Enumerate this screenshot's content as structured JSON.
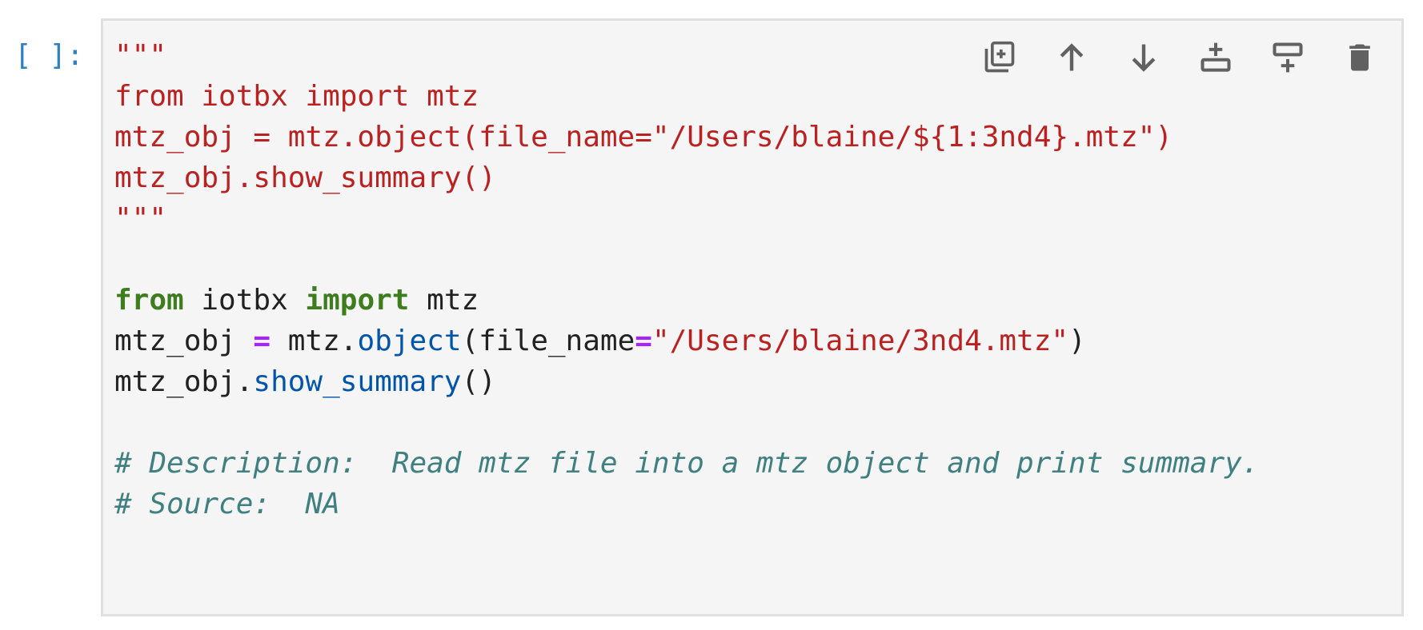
{
  "cell": {
    "prompt": "[ ]:",
    "toolbar": {
      "icons": [
        "duplicate-cell-icon",
        "move-up-icon",
        "move-down-icon",
        "insert-below-icon",
        "insert-above-icon",
        "delete-icon"
      ],
      "icon_color": "#616161"
    },
    "code": {
      "l1": "\"\"\"",
      "l2": "from iotbx import mtz",
      "l3": "mtz_obj = mtz.object(file_name=\"/Users/blaine/${1:3nd4}.mtz\")",
      "l4": "mtz_obj.show_summary()",
      "l5": "\"\"\"",
      "l7_kw1": "from",
      "l7_mid": " iotbx ",
      "l7_kw2": "import",
      "l7_end": " mtz",
      "l8_a": "mtz_obj ",
      "l8_op": "=",
      "l8_b": " mtz.",
      "l8_fn": "object",
      "l8_c": "(file_name",
      "l8_eq": "=",
      "l8_str": "\"/Users/blaine/3nd4.mtz\"",
      "l8_d": ")",
      "l9_a": "mtz_obj.",
      "l9_fn": "show_summary",
      "l9_b": "()",
      "l11": "# Description:  Read mtz file into a mtz object and print summary.",
      "l12": "# Source:  NA"
    },
    "colors": {
      "string": "#ba2121",
      "keyword": "#3d7d1e",
      "operator": "#aa22ff",
      "function": "#0055aa",
      "comment": "#408080",
      "prompt": "#307fc1",
      "editor_bg": "#f5f5f5"
    }
  }
}
